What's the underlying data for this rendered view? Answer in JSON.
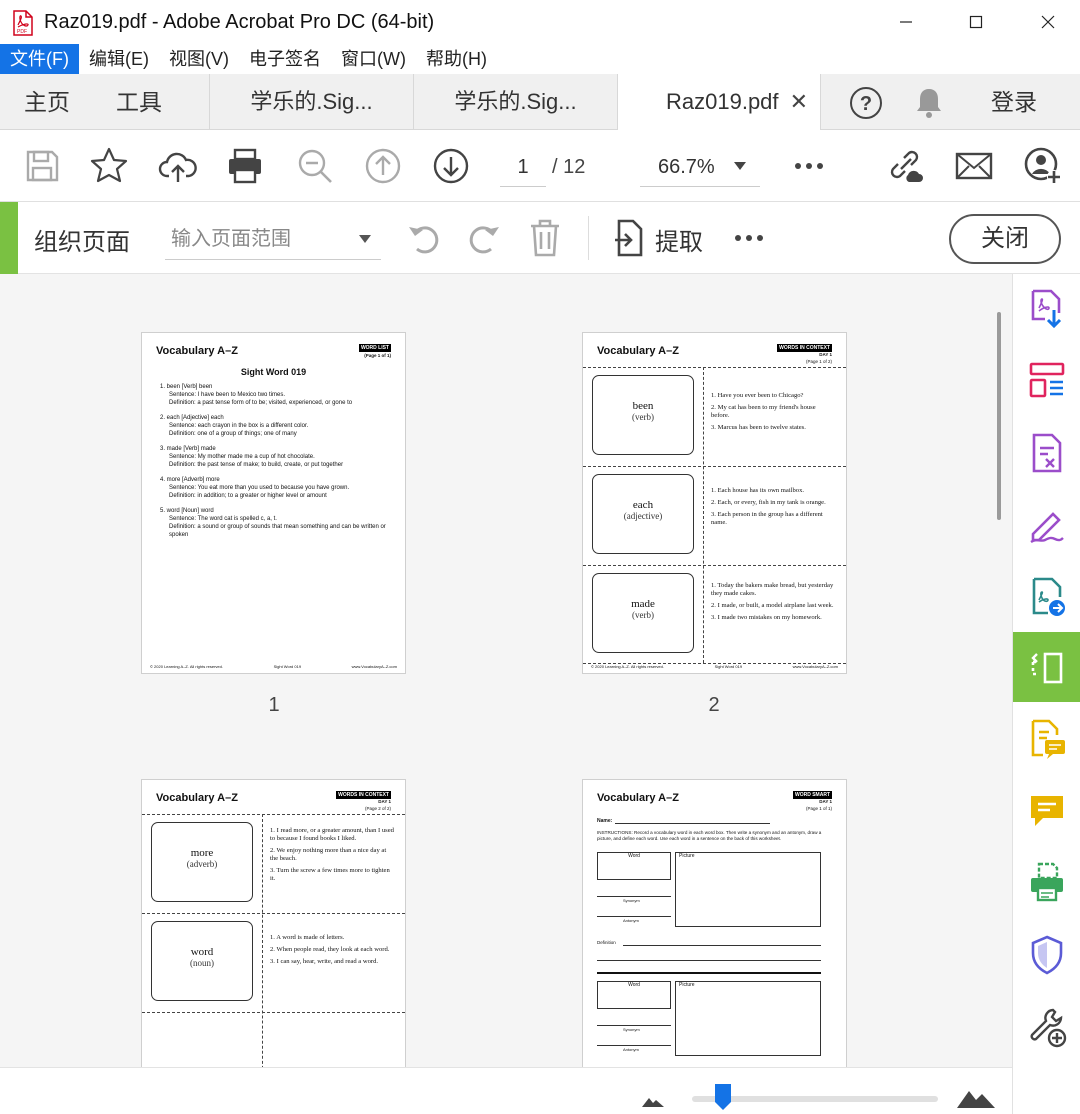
{
  "window": {
    "title": "Raz019.pdf - Adobe Acrobat Pro DC (64-bit)"
  },
  "menu": {
    "items": [
      "文件(F)",
      "编辑(E)",
      "视图(V)",
      "电子签名",
      "窗口(W)",
      "帮助(H)"
    ]
  },
  "tabs": {
    "home": "主页",
    "tools": "工具",
    "doc1": "学乐的.Sig...",
    "doc2": "学乐的.Sig...",
    "doc3": "Raz019.pdf",
    "login": "登录"
  },
  "toolbar": {
    "current_page": "1",
    "total_pages": "/ 12",
    "zoom": "66.7%"
  },
  "organize": {
    "title": "组织页面",
    "range_placeholder": "输入页面范围",
    "extract_label": "提取",
    "close_label": "关闭"
  },
  "pages": {
    "logo": "Vocabulary A–Z",
    "footer_left": "© 2020 Learning A–Z. All rights reserved.",
    "footer_right": "www.VocabularyA–Z.com",
    "p1": {
      "number": "1",
      "tag": "WORD LIST",
      "sub": "(Page 1 of 1)",
      "title": "Sight Word 019",
      "footer_mid": "Sight Word 019",
      "entries": [
        {
          "head": "1.  been [Verb] been",
          "s": "Sentence: I have been to Mexico two times.",
          "d": "Definition: a past tense form of to be; visited, experienced, or gone to"
        },
        {
          "head": "2.  each [Adjective] each",
          "s": "Sentence: each crayon in the box is a different color.",
          "d": "Definition: one of a group of things; one of many"
        },
        {
          "head": "3.  made [Verb] made",
          "s": "Sentence: My mother made me a cup of hot chocolate.",
          "d": "Definition: the past tense of make; to build, create, or put together"
        },
        {
          "head": "4.  more [Adverb] more",
          "s": "Sentence: You eat more than you used to because you have grown.",
          "d": "Definition: in addition; to a greater or higher level or amount"
        },
        {
          "head": "5.  word [Noun] word",
          "s": "Sentence: The word cat is spelled c, a, t.",
          "d": "Definition: a sound or group of sounds that mean something and can be written or spoken"
        }
      ]
    },
    "p2": {
      "number": "2",
      "tag": "WORDS IN CONTEXT",
      "sub": "DAY 1",
      "sub2": "(Page 1 of 2)",
      "footer_mid": "Sight Word 019",
      "cards": [
        {
          "word": "been",
          "pos": "(verb)",
          "s1": "1.  Have you ever been to Chicago?",
          "s2": "2.  My cat has been to my friend's house before.",
          "s3": "3.  Marcus has been to twelve states."
        },
        {
          "word": "each",
          "pos": "(adjective)",
          "s1": "1.  Each house has its own mailbox.",
          "s2": "2.  Each, or every, fish in my tank is orange.",
          "s3": "3.  Each person in the group has a different name."
        },
        {
          "word": "made",
          "pos": "(verb)",
          "s1": "1.  Today the bakers make bread, but yesterday they made cakes.",
          "s2": "2.  I made, or built, a model airplane last week.",
          "s3": "3.  I made two mistakes on my homework."
        }
      ]
    },
    "p3": {
      "tag": "WORDS IN CONTEXT",
      "sub": "DAY 1",
      "sub2": "(Page 2 of 2)",
      "cards": [
        {
          "word": "more",
          "pos": "(adverb)",
          "s1": "1.  I read more, or a greater amount, than I used to because I found books I liked.",
          "s2": "2.  We enjoy nothing more than a nice day at the beach.",
          "s3": "3.  Turn the screw a few times more to tighten it."
        },
        {
          "word": "word",
          "pos": "(noun)",
          "s1": "1.  A word is made of letters.",
          "s2": "2.  When people read, they look at each word.",
          "s3": "3.  I can say, hear, write, and read a word."
        }
      ]
    },
    "p4": {
      "tag": "WORD SMART",
      "sub": "DAY 1",
      "sub2": "(Page 1 of 1)",
      "name_label": "Name:",
      "instructions": "INSTRUCTIONS: Record a vocabulary word in each word box. Then write a synonym and an antonym, draw a picture, and define each word. Use each word in a sentence on the back of this worksheet.",
      "word_label": "Word",
      "picture_label": "Picture",
      "synonym_label": "Synonym",
      "antonym_label": "Antonym",
      "definition_label": "Definition"
    }
  },
  "colors": {
    "accent_green": "#7ac142",
    "menu_active": "#1473e6",
    "purple_icon": "#9b4dca",
    "blue_icon": "#1473e6"
  }
}
